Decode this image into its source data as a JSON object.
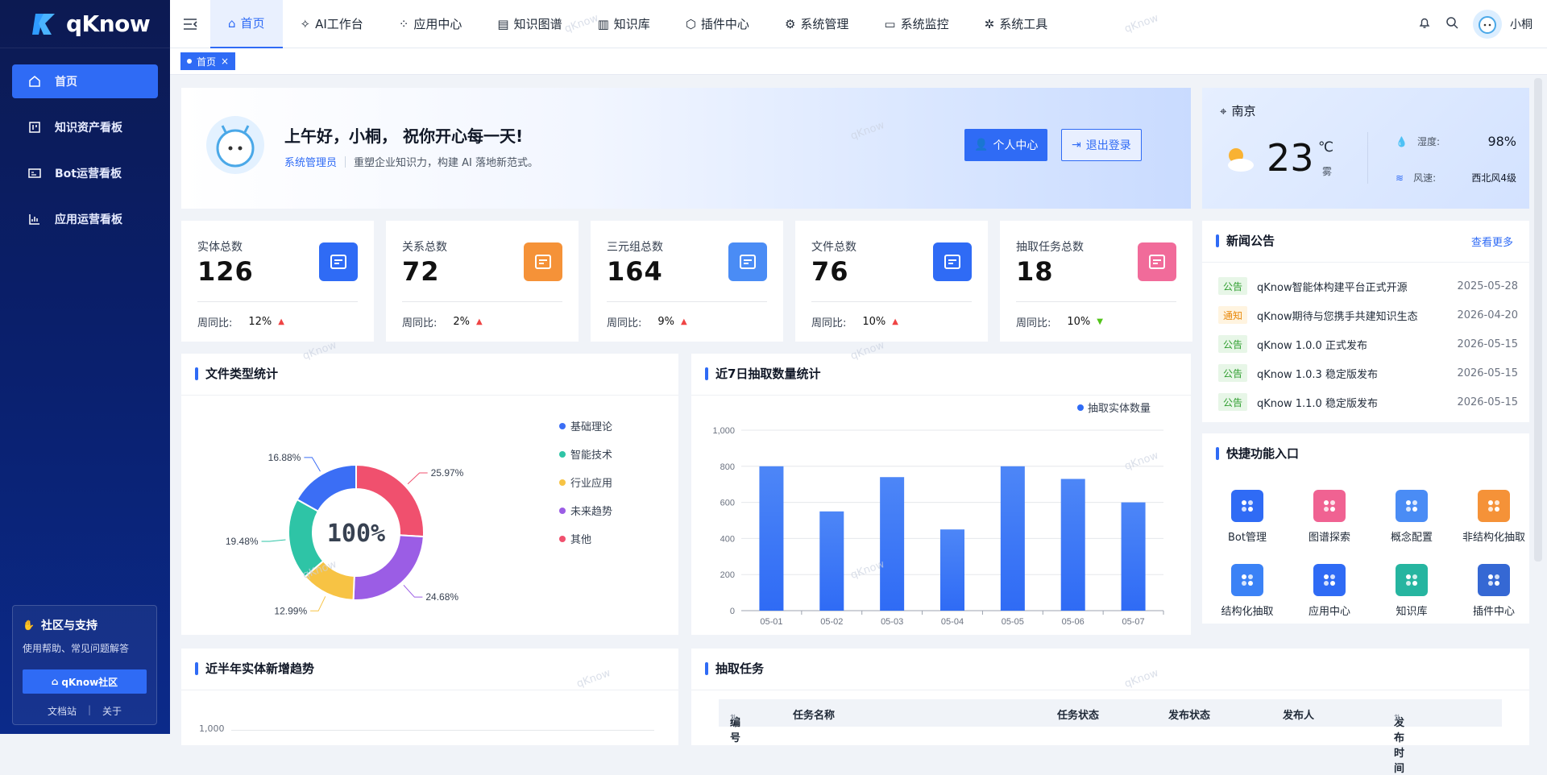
{
  "app": {
    "brand": "qKnow",
    "user": "小桐"
  },
  "sidebar": {
    "items": [
      {
        "label": "首页"
      },
      {
        "label": "知识资产看板"
      },
      {
        "label": "Bot运营看板"
      },
      {
        "label": "应用运营看板"
      }
    ],
    "support": {
      "title": "社区与支持",
      "desc": "使用帮助、常见问题解答",
      "button": "qKnow社区",
      "link1": "文档站",
      "link2": "关于"
    }
  },
  "nav": [
    "首页",
    "AI工作台",
    "应用中心",
    "知识图谱",
    "知识库",
    "插件中心",
    "系统管理",
    "系统监控",
    "系统工具"
  ],
  "tabs": {
    "home": "首页"
  },
  "welcome": {
    "greeting": "上午好，小桐， 祝你开心每一天!",
    "role": "系统管理员",
    "slogan": "重塑企业知识力，构建 AI 落地新范式。",
    "btn_profile": "个人中心",
    "btn_logout": "退出登录"
  },
  "weather": {
    "city": "南京",
    "temp": "23",
    "unit": "℃",
    "cond": "雾",
    "humidity_label": "湿度:",
    "humidity": "98%",
    "wind_label": "风速:",
    "wind": "西北风4级"
  },
  "stats": [
    {
      "label": "实体总数",
      "value": "126",
      "week": "周同比:",
      "pct": "12%",
      "dir": "up",
      "color": "#2f6bf5"
    },
    {
      "label": "关系总数",
      "value": "72",
      "week": "周同比:",
      "pct": "2%",
      "dir": "up",
      "color": "#f59238"
    },
    {
      "label": "三元组总数",
      "value": "164",
      "week": "周同比:",
      "pct": "9%",
      "dir": "up",
      "color": "#4a8cf5"
    },
    {
      "label": "文件总数",
      "value": "76",
      "week": "周同比:",
      "pct": "10%",
      "dir": "up",
      "color": "#2f6bf5"
    },
    {
      "label": "抽取任务总数",
      "value": "18",
      "week": "周同比:",
      "pct": "10%",
      "dir": "down",
      "color": "#f16b9a"
    }
  ],
  "news": {
    "title": "新闻公告",
    "more": "查看更多",
    "items": [
      {
        "badge": "公告",
        "type": "g",
        "text": "qKnow智能体构建平台正式开源",
        "date": "2025-05-28"
      },
      {
        "badge": "通知",
        "type": "o",
        "text": "qKnow期待与您携手共建知识生态",
        "date": "2026-04-20"
      },
      {
        "badge": "公告",
        "type": "g",
        "text": "qKnow 1.0.0 正式发布",
        "date": "2026-05-15"
      },
      {
        "badge": "公告",
        "type": "g",
        "text": "qKnow 1.0.3 稳定版发布",
        "date": "2026-05-15"
      },
      {
        "badge": "公告",
        "type": "g",
        "text": "qKnow 1.1.0 稳定版发布",
        "date": "2026-05-15"
      }
    ]
  },
  "quick": {
    "title": "快捷功能入口",
    "items": [
      {
        "label": "Bot管理",
        "color": "#2f6bf5"
      },
      {
        "label": "图谱探索",
        "color": "#f06292"
      },
      {
        "label": "概念配置",
        "color": "#4a8cf5"
      },
      {
        "label": "非结构化抽取",
        "color": "#f59238"
      },
      {
        "label": "结构化抽取",
        "color": "#3b82f6"
      },
      {
        "label": "应用中心",
        "color": "#2f6bf5"
      },
      {
        "label": "知识库",
        "color": "#26b5a0"
      },
      {
        "label": "插件中心",
        "color": "#3568d4"
      }
    ]
  },
  "filetype": {
    "title": "文件类型统计",
    "center": "100%"
  },
  "extract": {
    "title": "近7日抽取数量统计"
  },
  "trend": {
    "title": "近半年实体新增趋势",
    "y_top": "1,000"
  },
  "tasks": {
    "title": "抽取任务",
    "cols": [
      "编号",
      "任务名称",
      "任务状态",
      "发布状态",
      "发布人",
      "发布时间"
    ]
  },
  "watermark": "qKnow",
  "chart_data": [
    {
      "type": "pie",
      "title": "文件类型统计",
      "categories": [
        "基础理论",
        "智能技术",
        "行业应用",
        "未来趋势",
        "其他"
      ],
      "values": [
        16.88,
        19.48,
        12.99,
        24.68,
        25.97
      ],
      "colors": [
        "#3b6ef5",
        "#2ec4a6",
        "#f7c344",
        "#9b5de5",
        "#f0506e"
      ],
      "legend": "right"
    },
    {
      "type": "bar",
      "title": "近7日抽取数量统计",
      "categories": [
        "05-01",
        "05-02",
        "05-03",
        "05-04",
        "05-05",
        "05-06",
        "05-07"
      ],
      "series": [
        {
          "name": "抽取实体数量",
          "values": [
            800,
            550,
            740,
            450,
            800,
            730,
            600
          ]
        }
      ],
      "ylim": [
        0,
        1000
      ],
      "yticks": [
        "0",
        "200",
        "400",
        "600",
        "800",
        "1,000"
      ],
      "legend": "top-right"
    }
  ]
}
